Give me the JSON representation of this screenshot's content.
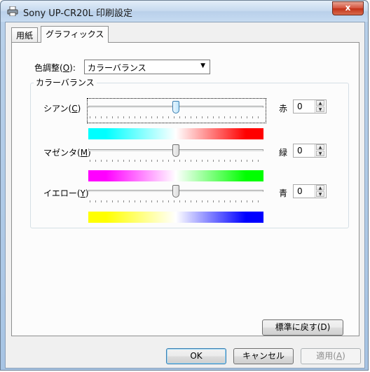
{
  "window": {
    "title": "Sony UP-CR20L 印刷設定",
    "close_label": "x"
  },
  "tabs": [
    {
      "label": "用紙",
      "active": false
    },
    {
      "label": "グラフィックス",
      "active": true
    }
  ],
  "color_adjust": {
    "label_prefix": "色調整(",
    "label_key": "O",
    "label_suffix": "):",
    "selected": "カラーバランス"
  },
  "color_balance": {
    "group_title": "カラーバランス",
    "sliders": [
      {
        "label_prefix": "シアン(",
        "label_key": "C",
        "label_suffix": ")",
        "right_label": "赤",
        "value": "0",
        "level": 0.5,
        "gradient": [
          "#00ffff",
          "#ffffff",
          "#ff0000"
        ]
      },
      {
        "label_prefix": "マゼンタ(",
        "label_key": "M",
        "label_suffix": ")",
        "right_label": "緑",
        "value": "0",
        "level": 0.5,
        "gradient": [
          "#ff00ff",
          "#ffffff",
          "#00ff00"
        ]
      },
      {
        "label_prefix": "イエロー(",
        "label_key": "Y",
        "label_suffix": ")",
        "right_label": "青",
        "value": "0",
        "level": 0.5,
        "gradient": [
          "#ffff00",
          "#ffffff",
          "#0000ff"
        ]
      }
    ]
  },
  "buttons": {
    "restore_default": "標準に戻す(D)",
    "ok": "OK",
    "cancel": "キャンセル",
    "apply_prefix": "適用(",
    "apply_key": "A",
    "apply_suffix": ")"
  }
}
